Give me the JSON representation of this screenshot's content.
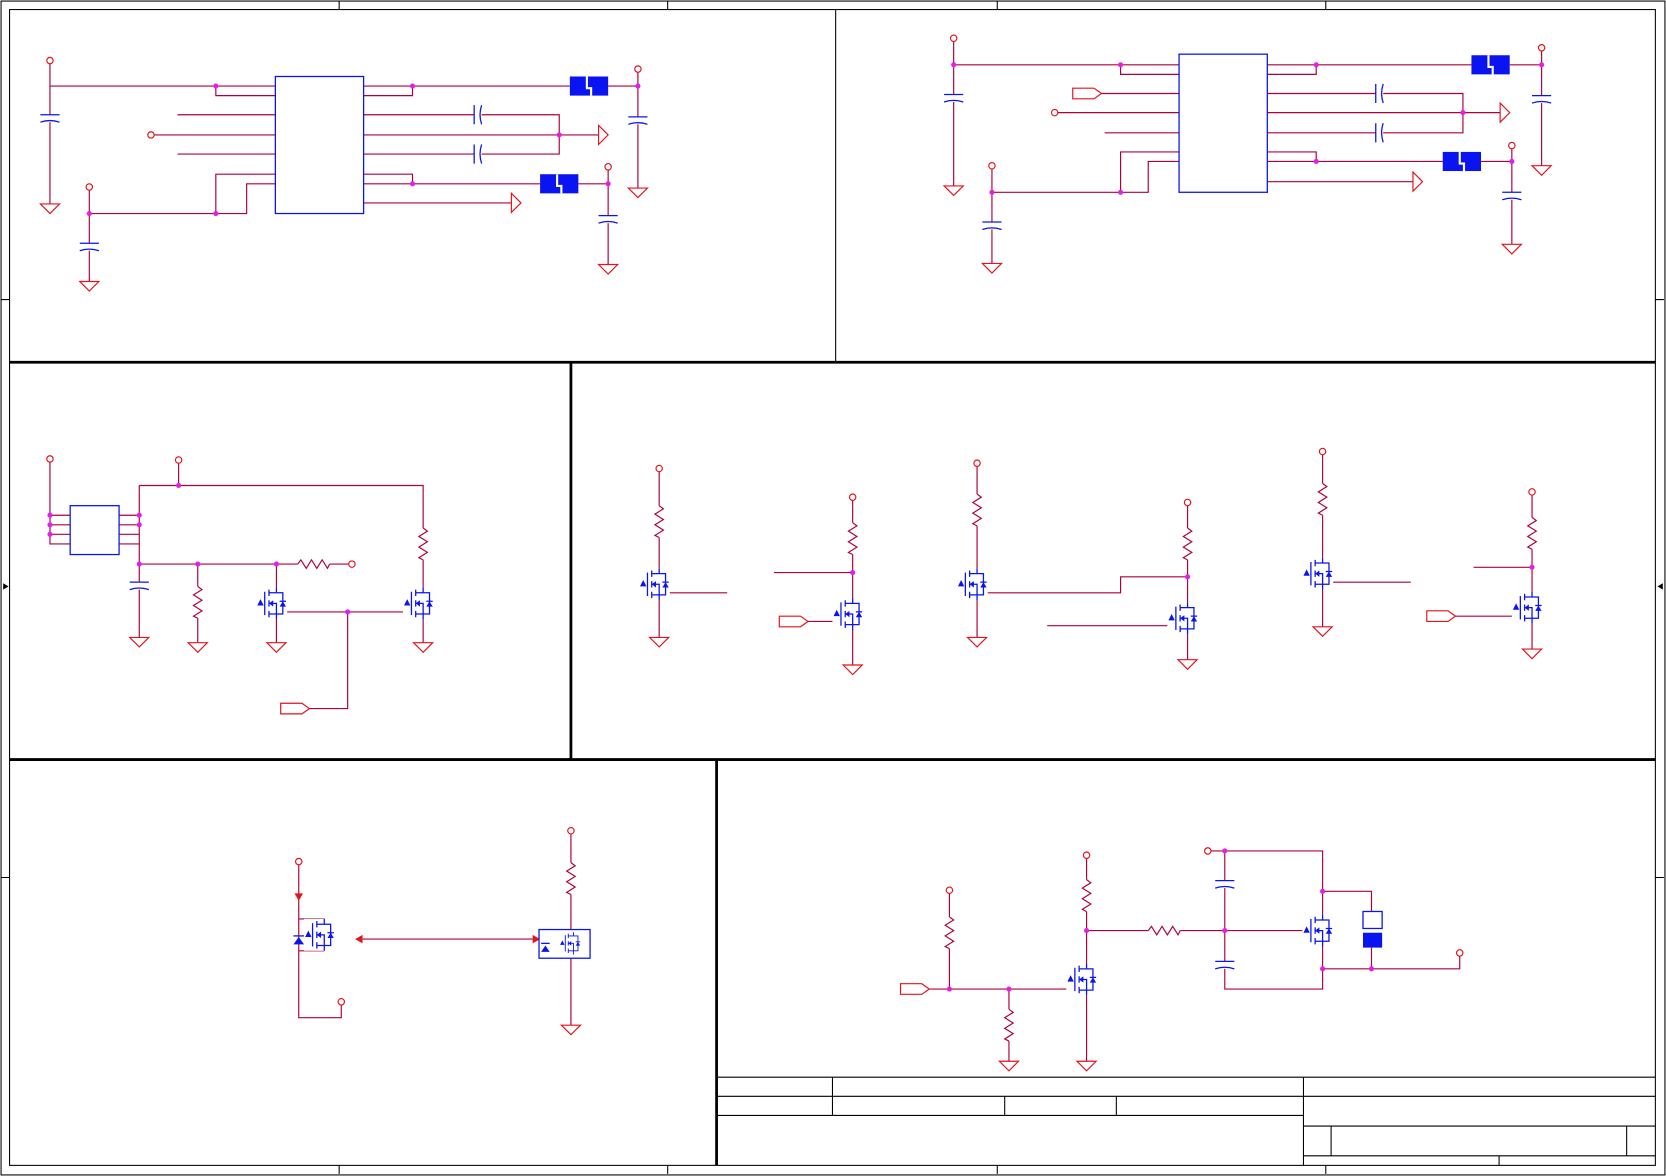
{
  "colors": {
    "wire": "#b0003c",
    "symbol": "#e4141b",
    "junction": "#e81ce8",
    "part": "#0a14f0",
    "frame": "#000000",
    "background": "#ffffff"
  },
  "icons": [
    "ground-symbol",
    "power-port-symbol",
    "capacitor-symbol",
    "resistor-symbol",
    "inductor-symbol",
    "power-flag-symbol",
    "off-page-port-symbol",
    "mosfet-symbol",
    "junction-dot",
    "ic-body"
  ]
}
